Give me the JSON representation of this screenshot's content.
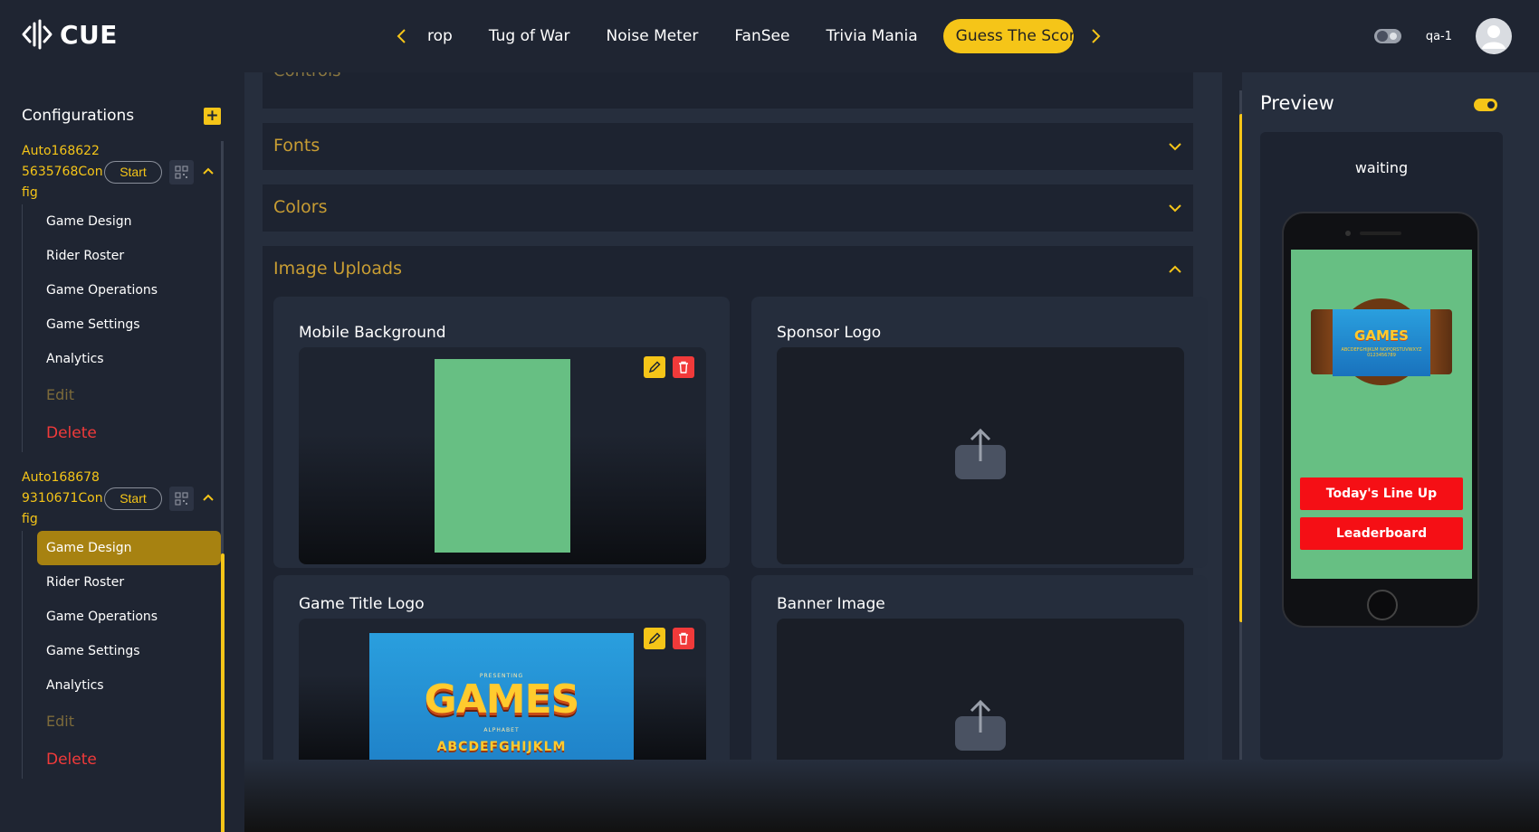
{
  "app": {
    "logo_text": "CUE"
  },
  "tabs": {
    "items": [
      "rop",
      "Tug of War",
      "Noise Meter",
      "FanSee",
      "Trivia Mania"
    ],
    "active": "Guess The Score"
  },
  "header": {
    "user_name": "qa-1"
  },
  "sidebar": {
    "title": "Configurations",
    "configs": [
      {
        "name": "Auto1686225635768Config",
        "start_label": "Start",
        "items": [
          "Game Design",
          "Rider Roster",
          "Game Operations",
          "Game Settings",
          "Analytics"
        ],
        "edit_label": "Edit",
        "delete_label": "Delete"
      },
      {
        "name": "Auto1686789310671Config",
        "start_label": "Start",
        "items": [
          "Game Design",
          "Rider Roster",
          "Game Operations",
          "Game Settings",
          "Analytics"
        ],
        "active_item": "Game Design",
        "edit_label": "Edit",
        "delete_label": "Delete"
      }
    ]
  },
  "main": {
    "cut_section": "Controls",
    "sections": {
      "fonts": "Fonts",
      "colors": "Colors",
      "image_uploads": "Image Uploads"
    },
    "uploads": {
      "mobile_background": "Mobile Background",
      "sponsor_logo": "Sponsor Logo",
      "game_title_logo": "Game Title Logo",
      "banner_image": "Banner Image"
    },
    "games_image": {
      "presenting": "PRESENTING",
      "title": "GAMES",
      "subtitle": "ALPHABET",
      "alphabet": "ABCDEFGHIJKLM"
    }
  },
  "preview": {
    "title": "Preview",
    "status": "waiting",
    "sign_title": "GAMES",
    "sign_alpha": "ABCDEFGHIJKLM NOPQRSTUVWXYZ 0123456789",
    "buttons": {
      "lineup": "Today's Line Up",
      "leaderboard": "Leaderboard"
    }
  },
  "colors": {
    "accent": "#f5c518",
    "danger": "#f13a3a",
    "background": "#1f2532",
    "panel": "#262e3d"
  }
}
